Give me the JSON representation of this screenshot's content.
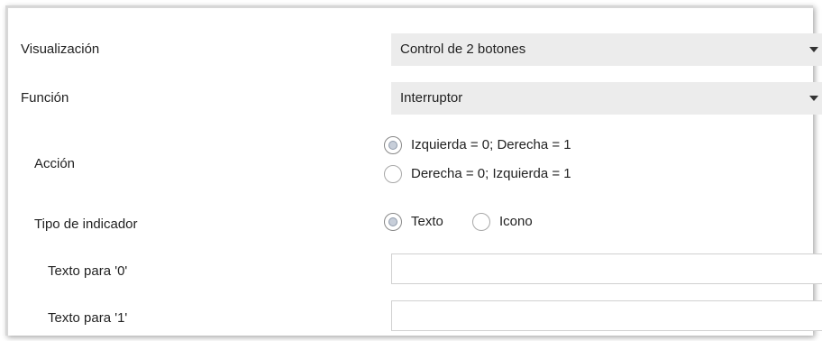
{
  "fields": {
    "visualizacion": {
      "label": "Visualización",
      "value": "Control de 2 botones"
    },
    "funcion": {
      "label": "Función",
      "value": "Interruptor"
    },
    "accion": {
      "label": "Acción",
      "options": [
        "Izquierda = 0; Derecha = 1",
        "Derecha = 0; Izquierda = 1"
      ],
      "selected": "Izquierda = 0; Derecha = 1"
    },
    "tipo_indicador": {
      "label": "Tipo de indicador",
      "options": [
        "Texto",
        "Icono"
      ],
      "selected": "Texto"
    },
    "texto_0": {
      "label": "Texto para '0'",
      "value": ""
    },
    "texto_1": {
      "label": "Texto para '1'",
      "value": ""
    }
  },
  "icons": {
    "dropdown": "chevron-down-icon",
    "radio": "radio-button-icon"
  }
}
